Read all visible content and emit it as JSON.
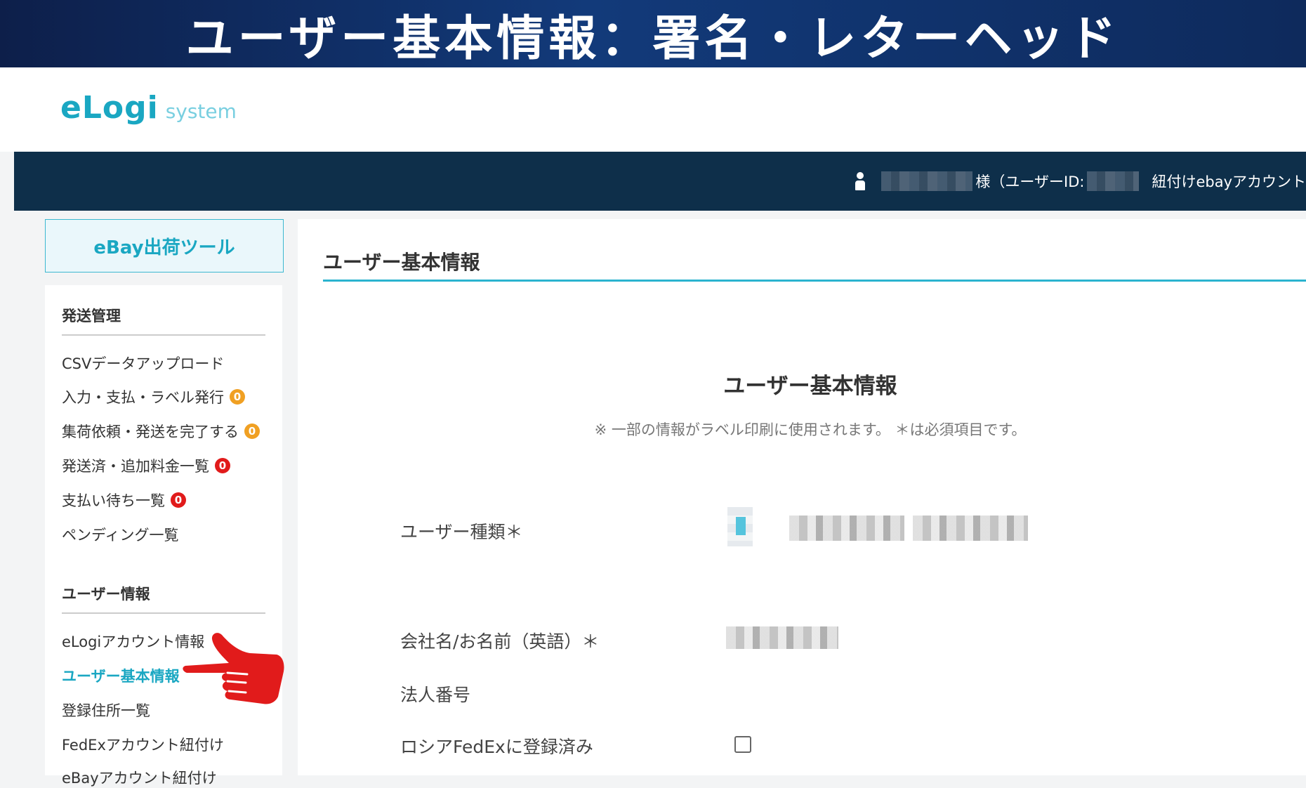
{
  "banner": {
    "title": "ユーザー基本情報：署名・レターヘッド"
  },
  "logo": {
    "main": "eLogi",
    "sub": "system"
  },
  "header": {
    "honorific": "様（ユーザーID:",
    "linked_account": "紐付けebayアカウント"
  },
  "sidebar": {
    "tool_title": "eBay出荷ツール",
    "sections": [
      {
        "heading": "発送管理",
        "items": [
          {
            "label": "CSVデータアップロード"
          },
          {
            "label": "入力・支払・ラベル発行",
            "badge": "0",
            "badge_color": "#f0a023"
          },
          {
            "label": "集荷依頼・発送を完了する",
            "badge": "0",
            "badge_color": "#f0a023"
          },
          {
            "label": "発送済・追加料金一覧",
            "badge": "0",
            "badge_color": "#e11b1b"
          },
          {
            "label": "支払い待ち一覧",
            "badge": "0",
            "badge_color": "#e11b1b"
          },
          {
            "label": "ペンディング一覧"
          }
        ]
      },
      {
        "heading": "ユーザー情報",
        "items": [
          {
            "label": "eLogiアカウント情報"
          },
          {
            "label": "ユーザー基本情報",
            "active": true
          },
          {
            "label": "登録住所一覧"
          },
          {
            "label": "FedExアカウント紐付け"
          },
          {
            "label": "eBayアカウント紐付け"
          }
        ]
      }
    ]
  },
  "main": {
    "page_title": "ユーザー基本情報",
    "form_title": "ユーザー基本情報",
    "form_note": "※ 一部の情報がラベル印刷に使用されます。 ＊は必須項目です。",
    "fields": {
      "user_type": "ユーザー種類＊",
      "company_name": "会社名/お名前（英語）＊",
      "corporate_number": "法人番号",
      "russia_fedex": "ロシアFedExに登録済み"
    }
  },
  "colors": {
    "accent": "#1aa7c2",
    "nav_bg": "#0e2f4a",
    "banner_bg": "#123a7a",
    "pointer": "#e11b1b"
  },
  "icons": {
    "user": "person-icon",
    "pointer": "pointing-hand-icon"
  }
}
